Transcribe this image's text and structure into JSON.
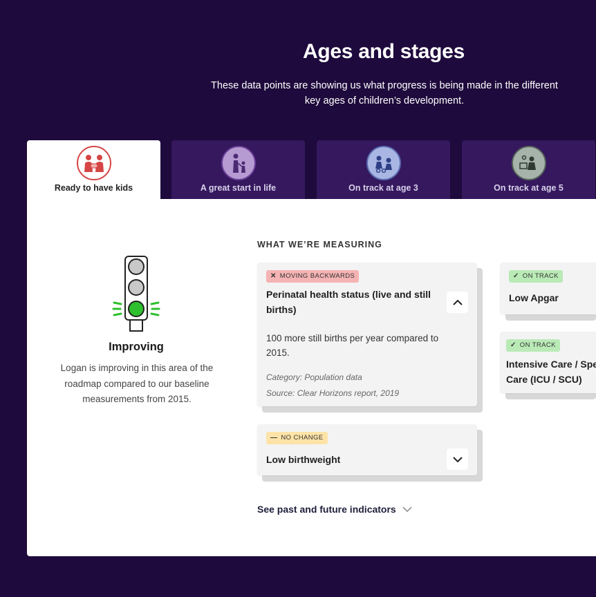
{
  "header": {
    "title": "Ages and stages",
    "subtitle": "These data points are showing us what progress is being made in the different key ages of children’s development."
  },
  "tabs": [
    {
      "label": "Ready to have kids",
      "icon": "parents-with-baby-icon",
      "active": true
    },
    {
      "label": "A great start in life",
      "icon": "parent-with-toddler-icon",
      "active": false
    },
    {
      "label": "On track at age 3",
      "icon": "kids-playing-icon",
      "active": false
    },
    {
      "label": "On track at age 5",
      "icon": "child-learning-icon",
      "active": false
    }
  ],
  "status": {
    "icon": "traffic-light-green-icon",
    "title": "Improving",
    "description": "Logan is improving in this area of the roadmap compared to our baseline measurements from 2015."
  },
  "measuring": {
    "heading": "WHAT WE’RE MEASURING",
    "cards": [
      {
        "badge": "MOVING BACKWARDS",
        "badge_icon": "✕",
        "title": "Perinatal health status (live and still births)",
        "body": "100 more still births per year compared to 2015.",
        "category": "Category: Population data",
        "source": "Source: Clear Horizons report, 2019",
        "expanded": true
      },
      {
        "badge": "NO CHANGE",
        "badge_icon": "—",
        "title": "Low birthweight",
        "expanded": false
      },
      {
        "badge": "ON TRACK",
        "badge_icon": "✓",
        "title": "Low Apgar"
      },
      {
        "badge": "ON TRACK",
        "badge_icon": "✓",
        "title": "Intensive Care / Special Care (ICU / SCU)"
      }
    ],
    "more_link": "See past and future indicators"
  },
  "colors": {
    "background": "#1e0a3c",
    "tab_inactive": "#35185e",
    "badge_backwards": "#f5b3b3",
    "badge_no_change": "#fde3a7",
    "badge_on_track": "#b9eab6",
    "light_green": "#2ec02e"
  }
}
